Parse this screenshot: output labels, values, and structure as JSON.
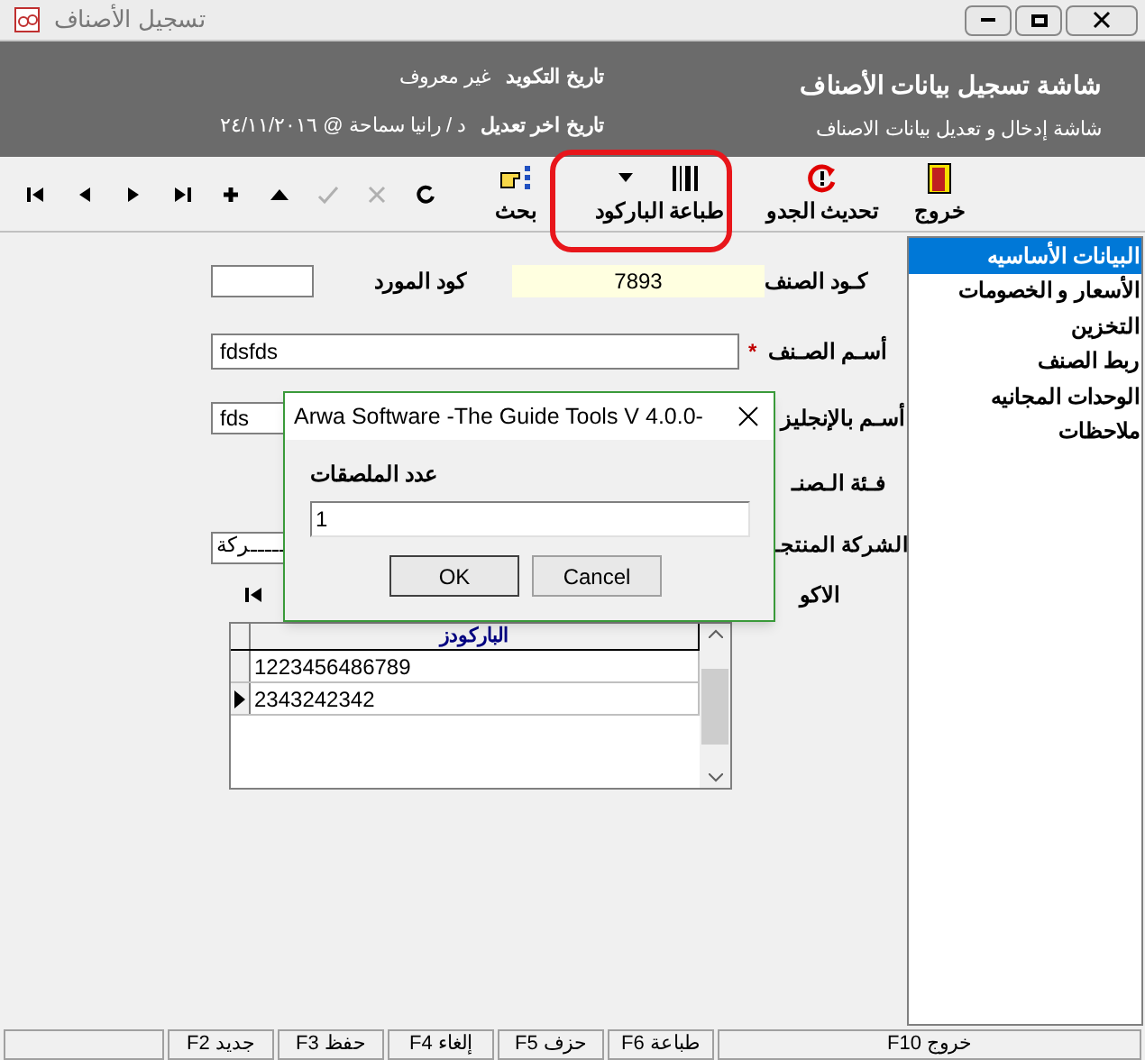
{
  "window": {
    "title": "تسجيل الأصناف"
  },
  "header": {
    "title": "شاشة تسجيل بيانات الأصناف",
    "subtitle": "شاشة إدخال و تعديل بيانات الاصناف",
    "coding_date_label": "تاريخ التكويد",
    "coding_date_value": "غير معروف",
    "last_edit_label": "تاريخ اخر تعديل",
    "last_edit_value": "د / رانيا سماحة @ ٢٤/١١/٢٠١٦"
  },
  "toolbar": {
    "buttons": [
      {
        "kind": "exit",
        "label": "خروج"
      },
      {
        "kind": "refresh",
        "label": "تحديث الجدو"
      },
      {
        "kind": "barcode",
        "label": "طباعة الباركود"
      },
      {
        "kind": "search",
        "label": "بحث"
      }
    ],
    "icons": [
      {
        "kind": "redo",
        "disabled": false
      },
      {
        "kind": "cancel",
        "disabled": true
      },
      {
        "kind": "confirm",
        "disabled": true
      },
      {
        "kind": "up",
        "disabled": false
      },
      {
        "kind": "plus",
        "disabled": false
      },
      {
        "kind": "last",
        "disabled": false
      },
      {
        "kind": "next",
        "disabled": false
      },
      {
        "kind": "prev",
        "disabled": false
      },
      {
        "kind": "first",
        "disabled": false
      }
    ]
  },
  "sidebar": {
    "items": [
      {
        "label": "البيانات الأساسيه",
        "selected": true
      },
      {
        "label": "الأسعار و الخصومات",
        "selected": false
      },
      {
        "label": "التخزين",
        "selected": false
      },
      {
        "label": "ربط الصنف",
        "selected": false
      },
      {
        "label": "الوحدات المجانيه",
        "selected": false
      },
      {
        "label": "ملاحظات",
        "selected": false
      }
    ]
  },
  "form": {
    "item_code_label": "كـود الصنف",
    "item_code": "7893",
    "supplier_code_label": "كود المورد",
    "name_label": "أسـم الصـنف",
    "required_mark": "*",
    "name": "fdsfds",
    "english_name_label": "أسـم بالإنجليز",
    "english_name": "fds",
    "category_label": "فـئة الـصنـ",
    "company_label": "الشركة المنتجـ",
    "company": "ـــــركة",
    "barcodes_label": "الاكو"
  },
  "barcode_table": {
    "column": "الباركودز",
    "rows": [
      {
        "value": "1223456486789",
        "selected": false
      },
      {
        "value": "2343242342",
        "selected": true
      }
    ]
  },
  "dialog": {
    "title": "Arwa Software -The Guide Tools V 4.0.0-",
    "label": "عدد الملصقات",
    "value": "1",
    "buttons": [
      "Cancel",
      "OK"
    ]
  },
  "status_bar": [
    "خروج F10",
    "طباعة F6",
    "حزف F5",
    "إلغاء F4",
    "حفظ F3",
    "جديد F2"
  ]
}
